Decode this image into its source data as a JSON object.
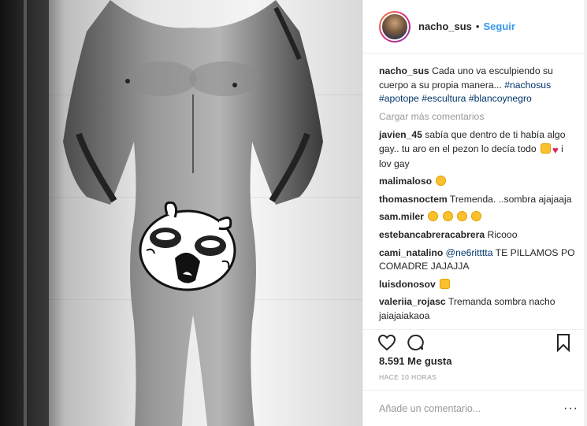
{
  "header": {
    "username": "nacho_sus",
    "separator": "•",
    "follow_label": "Seguir"
  },
  "caption": {
    "username": "nacho_sus",
    "text": "Cada uno va esculpiendo su cuerpo a su propia manera...",
    "hashtags": [
      "#nachosus",
      "#apotope",
      "#escultura",
      "#blancoynegro"
    ]
  },
  "load_more": "Cargar más comentarios",
  "comments": [
    {
      "username": "javien_45",
      "text": "sabía que dentro de ti había algo gay.. tu aro en el pezon lo decía todo",
      "text2": "i lov gay"
    },
    {
      "username": "malimaloso",
      "text": ""
    },
    {
      "username": "thomasnoctem",
      "text": "Tremenda. ..sombra ajajaaja"
    },
    {
      "username": "sam.miler",
      "text": ""
    },
    {
      "username": "estebancabreracabrera",
      "text": "Ricooo"
    },
    {
      "username": "cami_natalino",
      "mention": "@ne6ritttta",
      "text": "TE PILLAMOS PO COMADRE JAJAJJA"
    },
    {
      "username": "luisdonosov",
      "text": ""
    },
    {
      "username": "valeriia_rojasc",
      "text": "Tremanda sombra nacho jaiajaiakaoa"
    }
  ],
  "likes": "8.591 Me gusta",
  "timestamp": "HACE 10 HORAS",
  "add_comment": {
    "placeholder": "Añade un comentario..."
  },
  "more_label": "···",
  "icons": [
    "heart-icon",
    "comment-icon",
    "bookmark-icon"
  ]
}
